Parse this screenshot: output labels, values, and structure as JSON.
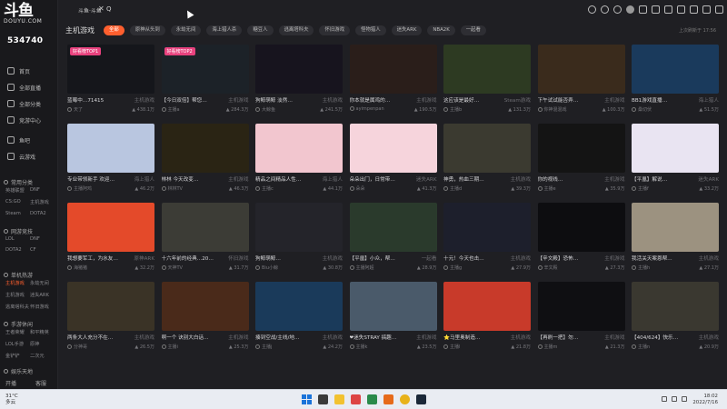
{
  "app": {
    "logo_text": "斗鱼",
    "logo_sub": "DOUYU.COM",
    "user_number": "534740",
    "window_tab": "斗鱼·斗鱼",
    "tab_extra": "Q"
  },
  "sidebar": {
    "items": [
      {
        "label": "首页",
        "icon": "home-icon"
      },
      {
        "label": "全部直播",
        "icon": "grid-icon"
      },
      {
        "label": "全部分类",
        "icon": "category-icon"
      },
      {
        "label": "竞游中心",
        "icon": "game-center-icon"
      },
      {
        "label": "鱼吧",
        "icon": "fish-icon"
      },
      {
        "label": "云游戏",
        "icon": "cloud-game-icon"
      }
    ],
    "groups": [
      {
        "title": "常用分类",
        "items": [
          "英雄联盟",
          "DNF",
          "CS:GO",
          "主机游戏",
          "Steam",
          "DOTA2"
        ]
      },
      {
        "title": "网游竞技",
        "items": [
          "LOL",
          "DNF",
          "DOTA2",
          "CF"
        ]
      },
      {
        "title": "单机热游",
        "items": [
          "主机游戏",
          "永劫无间",
          "主机游戏",
          "迷失ARK",
          "逃离塔科夫",
          "怀旧游戏"
        ]
      },
      {
        "title": "手游休闲",
        "items": [
          "王者荣耀",
          "和平精英",
          "LOL手游",
          "原神",
          "金铲铲",
          "二次元"
        ]
      },
      {
        "title": "娱乐天地",
        "items": [
          "户外",
          "颜值"
        ]
      }
    ],
    "footer": [
      "开播",
      "客服"
    ]
  },
  "header": {
    "category_title": "主机游戏",
    "pills": [
      "全部",
      "原神从头到",
      "永劫无间",
      "海上猎人杀",
      "糖豆人",
      "逃离塔科夫",
      "怀旧游戏",
      "怪物猎人",
      "迷失ARK",
      "NBA2K",
      "一起看"
    ],
    "active_pill": 0,
    "update_text": "上次刷新于 17:56"
  },
  "cards": [
    {
      "title": "蓝莓中…71415",
      "sub": "主机游戏",
      "user": "天了",
      "hot": "438.1万",
      "tag": "好看榜TOP1",
      "bg": "#15161b"
    },
    {
      "title": "【今日双倍】帮您…",
      "sub": "主机游戏",
      "user": "主播a",
      "hot": "284.3万",
      "tag": "好看榜TOP2",
      "bg": "#1c2228"
    },
    {
      "title": "狗鲸萌鲸 淡然…",
      "sub": "主机游戏",
      "user": "大鲸鱼",
      "hot": "241.5万",
      "tag": "",
      "bg": "#17141e"
    },
    {
      "title": "你本就是属鸡的…",
      "sub": "主机游戏",
      "user": "ayimpenpan",
      "hot": "190.5万",
      "tag": "",
      "bg": "#2a1e1a"
    },
    {
      "title": "这应该是最好…",
      "sub": "Steam游戏",
      "user": "主播b",
      "hot": "131.3万",
      "tag": "",
      "bg": "#2d3a22"
    },
    {
      "title": "下午试试能否弄…",
      "sub": "主机游戏",
      "user": "你神混混戏",
      "hot": "100.3万",
      "tag": "",
      "bg": "#3a2b1c"
    },
    {
      "title": "BB1游戏直播…",
      "sub": "海上猎人",
      "user": "桑切伏",
      "hot": "51.5万",
      "tag": "",
      "bg": "#1a3a5c"
    },
    {
      "title": "专业带领新手 欢迎…",
      "sub": "海上猎人",
      "user": "主播阿鸡",
      "hot": "46.2万",
      "tag": "",
      "bg": "#b9c6e0"
    },
    {
      "title": "林林 今天改变…",
      "sub": "主机游戏",
      "user": "林林TV",
      "hot": "46.3万",
      "tag": "",
      "bg": "#2a2414"
    },
    {
      "title": "精品之间精品人性…",
      "sub": "海上猎人",
      "user": "主播c",
      "hot": "44.1万",
      "tag": "",
      "bg": "#f2c6cf"
    },
    {
      "title": "朵朵出门，日常带…",
      "sub": "迷失ARK",
      "user": "朵朵",
      "hot": "41.3万",
      "tag": "",
      "bg": "#f6d4dc"
    },
    {
      "title": "神勇，热血三期…",
      "sub": "主机游戏",
      "user": "主播d",
      "hot": "39.3万",
      "tag": "",
      "bg": "#3b3a30"
    },
    {
      "title": "你的视线…",
      "sub": "主机游戏",
      "user": "主播e",
      "hot": "35.9万",
      "tag": "",
      "bg": "#141414"
    },
    {
      "title": "【平凰】解说…",
      "sub": "迷失ARK",
      "user": "主播f",
      "hot": "33.2万",
      "tag": "",
      "bg": "#e9e4f2"
    },
    {
      "title": "我想要军工，为水友…",
      "sub": "原神ARK",
      "user": "海猪猪",
      "hot": "32.2万",
      "tag": "",
      "bg": "#e44a2a"
    },
    {
      "title": "十六年前的经典…20…",
      "sub": "怀旧游戏",
      "user": "天神TV",
      "hot": "31.7万",
      "tag": "",
      "bg": "#3c3c36"
    },
    {
      "title": "狗鲸萌鲸…",
      "sub": "主机游戏",
      "user": "Biu小鲸",
      "hot": "30.8万",
      "tag": "",
      "bg": "#24242a"
    },
    {
      "title": "【平凰】小众，帮…",
      "sub": "一起看",
      "user": "主播阿超",
      "hot": "28.9万",
      "tag": "",
      "bg": "#2a3a2c"
    },
    {
      "title": "十元！今天也击…",
      "sub": "主机游戏",
      "user": "主播g",
      "hot": "27.9万",
      "tag": "",
      "bg": "#1d1f2c"
    },
    {
      "title": "【辛文殿】恐怖…",
      "sub": "主机游戏",
      "user": "辛文殿",
      "hot": "27.3万",
      "tag": "",
      "bg": "#0d0d10"
    },
    {
      "title": "我活关天案恩帮…",
      "sub": "主机游戏",
      "user": "主播h",
      "hot": "27.1万",
      "tag": "",
      "bg": "#9c9280"
    },
    {
      "title": "两条大人充分不在…",
      "sub": "主机游戏",
      "user": "分神哥",
      "hot": "26.5万",
      "tag": "",
      "bg": "#3a3326"
    },
    {
      "title": "啊一个 诀别大白话…",
      "sub": "主机游戏",
      "user": "主播i",
      "hot": "25.3万",
      "tag": "",
      "bg": "#4a2a1a"
    },
    {
      "title": "揍到空战/主线/地…",
      "sub": "主机游戏",
      "user": "主播j",
      "hot": "24.2万",
      "tag": "",
      "bg": "#1a3a5a"
    },
    {
      "title": "❤迷失STRAY 搞趣…",
      "sub": "主机游戏",
      "user": "主播k",
      "hot": "23.5万",
      "tag": "",
      "bg": "#4a5a6a"
    },
    {
      "title": "⭐马里奥制造…",
      "sub": "主机游戏",
      "user": "主播l",
      "hot": "21.8万",
      "tag": "",
      "bg": "#c83a2a"
    },
    {
      "title": "【再刷一把】勿…",
      "sub": "主机游戏",
      "user": "主播m",
      "hot": "21.3万",
      "tag": "",
      "bg": "#0f0f12"
    },
    {
      "title": "【404/624】快乐…",
      "sub": "主机游戏",
      "user": "主播n",
      "hot": "20.9万",
      "tag": "",
      "bg": "#3a3830"
    }
  ],
  "taskbar": {
    "weather": "31°C",
    "weather_sub": "多云",
    "time": "18:02",
    "date": "2022/7/16"
  }
}
